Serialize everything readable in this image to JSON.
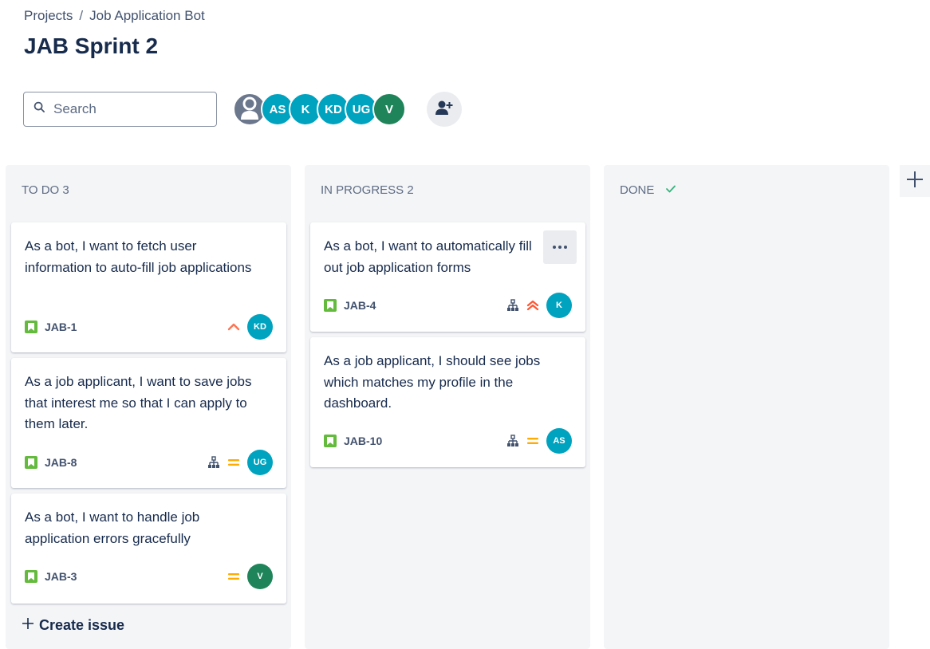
{
  "breadcrumb": {
    "projects": "Projects",
    "separator": "/",
    "project": "Job Application Bot"
  },
  "page_title": "JAB Sprint 2",
  "search": {
    "placeholder": "Search"
  },
  "members": [
    {
      "initials": "",
      "color": "#6b778c",
      "icon": "person-icon"
    },
    {
      "initials": "AS",
      "color": "#00a3bf"
    },
    {
      "initials": "K",
      "color": "#00a3bf"
    },
    {
      "initials": "KD",
      "color": "#00a3bf"
    },
    {
      "initials": "UG",
      "color": "#00a3bf"
    },
    {
      "initials": "V",
      "color": "#1f845a"
    }
  ],
  "columns": [
    {
      "title": "TO DO 3",
      "cards": [
        {
          "summary": "As a bot, I want to fetch user information to auto-fill job applications",
          "key": "JAB-1",
          "priority": "high",
          "has_subtasks": false,
          "assignee": "KD",
          "assignee_color": "#00a3bf"
        },
        {
          "summary": "As a job applicant, I want to save jobs that interest me so that I can apply to them later.",
          "key": "JAB-8",
          "priority": "medium",
          "has_subtasks": true,
          "assignee": "UG",
          "assignee_color": "#00a3bf"
        },
        {
          "summary": "As a bot, I want to handle job application errors gracefully",
          "key": "JAB-3",
          "priority": "medium",
          "has_subtasks": false,
          "assignee": "V",
          "assignee_color": "#1f845a"
        }
      ],
      "create_label": "Create issue"
    },
    {
      "title": "IN PROGRESS 2",
      "cards": [
        {
          "summary": "As a bot, I want to automatically fill out job application forms",
          "key": "JAB-4",
          "priority": "highest",
          "has_subtasks": true,
          "assignee": "K",
          "assignee_color": "#00a3bf"
        },
        {
          "summary": "As a job applicant, I should see jobs which matches my profile in the dashboard.",
          "key": "JAB-10",
          "priority": "medium",
          "has_subtasks": true,
          "assignee": "AS",
          "assignee_color": "#00a3bf"
        }
      ]
    },
    {
      "title": "DONE",
      "cards": []
    }
  ],
  "colors": {
    "accent": "#0052cc",
    "story_green": "#63ba3c",
    "priority_orange": "#ff7452",
    "priority_medium": "#ffab00",
    "done_check": "#36b37e"
  }
}
